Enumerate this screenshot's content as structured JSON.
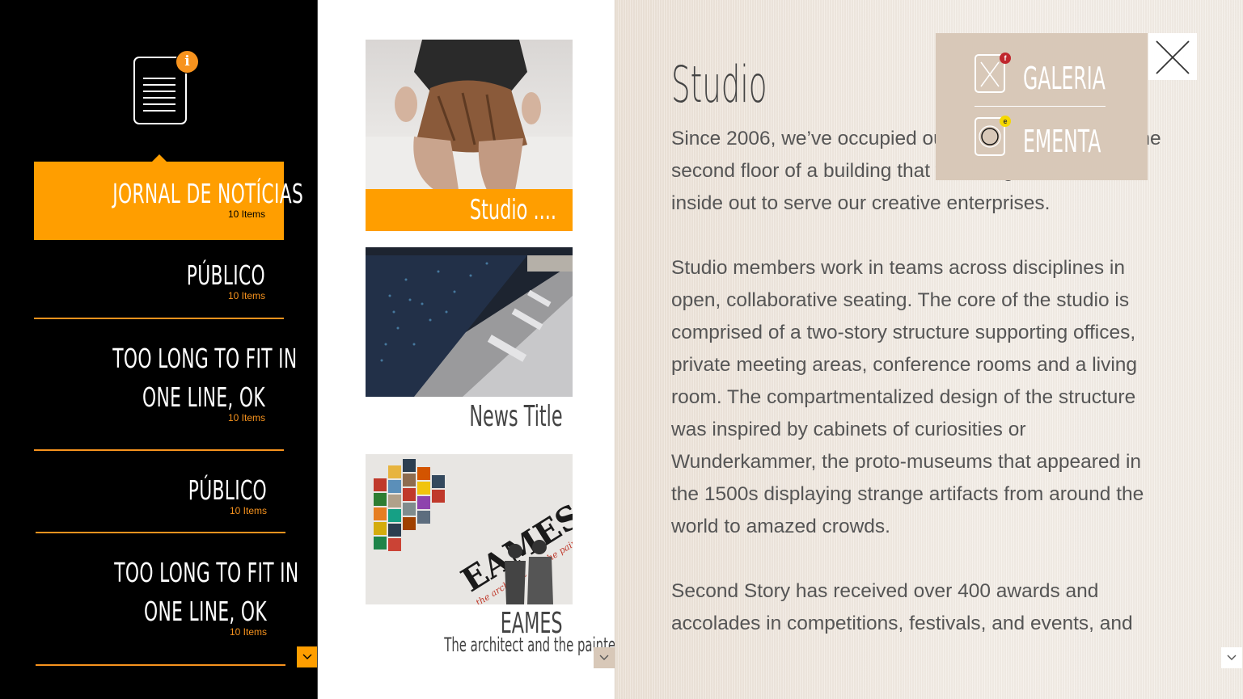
{
  "sidebar": {
    "items": [
      {
        "title": "JORNAL DE NOTÍCIAS",
        "count": "10 Items",
        "active": true
      },
      {
        "title": "PÚBLICO",
        "count": "10 Items"
      },
      {
        "title_line1": "TOO LONG TO FIT IN",
        "title_line2": "ONE LINE, OK",
        "count": "10 Items"
      },
      {
        "title": "PÚBLICO",
        "count": "10 Items"
      },
      {
        "title_line1": "TOO LONG TO FIT IN",
        "title_line2": "ONE LINE, OK",
        "count": "10 Items"
      }
    ],
    "badge": "i"
  },
  "cards": [
    {
      "caption": "Studio ...."
    },
    {
      "title": "News Title"
    },
    {
      "title": "EAMES",
      "subtitle": "The architect and the painter",
      "poster_text": "EAMES",
      "poster_sub": "the architect and the painter"
    }
  ],
  "article": {
    "title": "Studio",
    "paragraphs": [
      "Since 2006, we’ve occupied our office and studio on the second floor of a building that we designed from the inside out to serve our creative enterprises.",
      "Studio members work in teams across disciplines in open, collaborative seating. The core of the studio is comprised of a two-story structure supporting offices, private meeting areas, conference rooms and a living room. The compartmentalized design of the structure was inspired by cabinets of curiosities or Wunderkammer, the proto-museums that appeared in the 1500s displaying strange artifacts from around the world to amazed crowds.",
      "Second Story has received over 400 awards and accolades in competitions, festivals, and events, and"
    ]
  },
  "popup": {
    "items": [
      {
        "label": "GALERIA",
        "badge": "f"
      },
      {
        "label": "EMENTA",
        "badge": "e"
      }
    ]
  },
  "colors": {
    "accent": "#ff9e00",
    "sidebar_bg": "#000000",
    "popup_bg": "#d8c8b8"
  }
}
